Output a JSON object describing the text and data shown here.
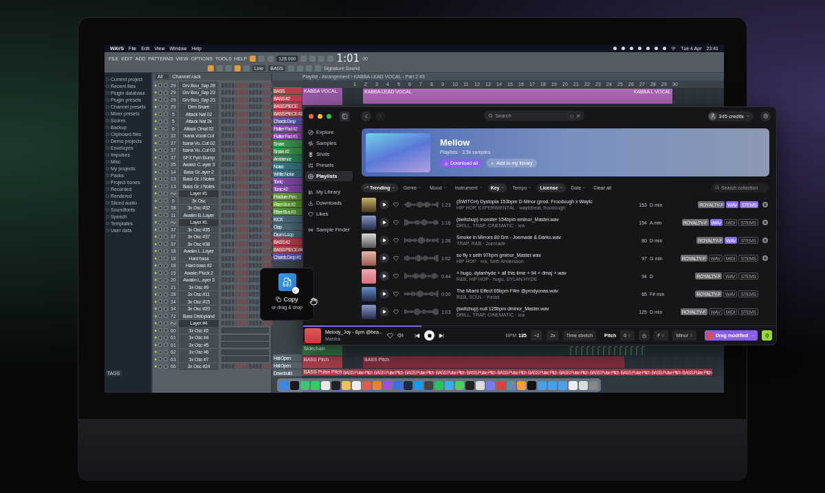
{
  "mac_menu_bar": {
    "app": "WAVS",
    "items": [
      "File",
      "Edit",
      "View",
      "Window",
      "Help"
    ],
    "date": "Tue 4 Apr",
    "time": "23:41"
  },
  "daw": {
    "menu": [
      "FILE",
      "EDIT",
      "ADD",
      "PATTERNS",
      "VIEW",
      "OPTIONS",
      "TOOLS",
      "HELP"
    ],
    "tempo": "128.000",
    "time": "1:01",
    "time_small": "00",
    "snap": "Line",
    "pattern": "BASS",
    "hint": "Signature Sound",
    "browser": {
      "items": [
        "Current project",
        "Recent files",
        "Plugin database",
        "Plugin presets",
        "Channel presets",
        "Mixer presets",
        "Scores",
        "Backup",
        "Clipboard files",
        "Demo projects",
        "Envelopes",
        "Impulses",
        "Misc",
        "My projects",
        "Packs",
        "Project bones",
        "Recorded",
        "Rendered",
        "Sliced audio",
        "Soundfonts",
        "Speech",
        "Templates",
        "User data"
      ],
      "tags": "TAGS"
    },
    "channel_rack": {
      "filter": "All",
      "title": "Channel rack",
      "channels": [
        {
          "number": "29",
          "name": "Grv Bou_Sap 28",
          "kind": "steps"
        },
        {
          "number": "29",
          "name": "Grv Bou_Sap 23",
          "kind": "steps"
        },
        {
          "number": "29",
          "name": "Grv Bou_Sap 23",
          "kind": "steps"
        },
        {
          "number": "29",
          "name": "Drm Snare",
          "kind": "steps"
        },
        {
          "number": "5",
          "name": "Attack Nat 02",
          "kind": "steps"
        },
        {
          "number": "5",
          "name": "Attack Nat 2k",
          "kind": "steps"
        },
        {
          "number": "6",
          "name": "Attack OHat 02",
          "kind": "steps"
        },
        {
          "number": "32",
          "name": "Isana Vocal Cut",
          "kind": "steps"
        },
        {
          "number": "37",
          "name": "Isana Vo..Cut 02",
          "kind": "steps"
        },
        {
          "number": "37",
          "name": "Isana Vo..Cut 03",
          "kind": "steps"
        },
        {
          "number": "37",
          "name": "SFX Fym Bump",
          "kind": "steps"
        },
        {
          "number": "35",
          "name": "Awakn C..ayer 3",
          "kind": "steps"
        },
        {
          "number": "14",
          "name": "Bass Gr..ayer 2",
          "kind": "steps"
        },
        {
          "number": "13",
          "name": "Bass Gr..I Notes",
          "kind": "steps"
        },
        {
          "number": "13",
          "name": "Bass Gr..I Notes",
          "kind": "steps"
        },
        {
          "name": "Layer #1",
          "kind": "steps"
        },
        {
          "number": "9",
          "name": "3x Osc",
          "kind": "steps"
        },
        {
          "number": "38",
          "name": "3x Osc #32",
          "kind": "steps"
        },
        {
          "number": "11",
          "name": "Awakn B..Layer",
          "kind": "steps"
        },
        {
          "name": "Layer #1",
          "kind": "steps"
        },
        {
          "number": "37",
          "name": "3x Osc #35",
          "kind": "steps"
        },
        {
          "number": "37",
          "name": "3x Osc #37",
          "kind": "steps"
        },
        {
          "number": "37",
          "name": "3x Osc #38",
          "kind": "steps"
        },
        {
          "number": "18",
          "name": "Awakn L..Layer",
          "kind": "steps"
        },
        {
          "number": "18",
          "name": "Hard bass",
          "kind": "steps"
        },
        {
          "number": "18",
          "name": "Hard bass #2",
          "kind": "steps"
        },
        {
          "number": "15",
          "name": "Awakn Pluck 2",
          "kind": "steps"
        },
        {
          "number": "20",
          "name": "Awakn L..ayer 3",
          "kind": "steps"
        },
        {
          "number": "21",
          "name": "3x Osc #9",
          "kind": "steps"
        },
        {
          "number": "28",
          "name": "3x Osc #11",
          "kind": "steps"
        },
        {
          "number": "34",
          "name": "3x Osc #15",
          "kind": "steps"
        },
        {
          "number": "34",
          "name": "3x Osc #20",
          "kind": "steps"
        },
        {
          "number": "72",
          "name": "Bass Distopiand",
          "kind": "steps"
        },
        {
          "name": "Layer #4",
          "kind": "steps"
        },
        {
          "number": "60",
          "name": "3x Osc #2",
          "kind": "roll"
        },
        {
          "number": "61",
          "name": "3x Osc #4",
          "kind": "roll"
        },
        {
          "number": "61",
          "name": "3x Osc #5",
          "kind": "roll"
        },
        {
          "number": "62",
          "name": "3x Osc #6",
          "kind": "roll"
        },
        {
          "number": "63",
          "name": "3x Osc #7",
          "kind": "roll"
        },
        {
          "number": "66",
          "name": "3x Osc #24",
          "kind": "steps"
        }
      ]
    },
    "playlist": {
      "title": "Playlist - Arrangement › KABBA LEAD VOCAL - Part 2 #3",
      "patterns": [
        {
          "name": "BASS",
          "color": "#b8404c"
        },
        {
          "name": "BASS #2",
          "color": "#b8404c"
        },
        {
          "name": "BASS PIECE",
          "color": "#b8404c"
        },
        {
          "name": "BASS PIECE #2",
          "color": "#b8404c"
        },
        {
          "name": "Chords Drop",
          "color": "#5a58b4"
        },
        {
          "name": "Flutter Pad #2",
          "color": "#8a48b4"
        },
        {
          "name": "Flutter Pad #3",
          "color": "#8a48b4"
        },
        {
          "name": "Snare",
          "color": "#3a9a4c"
        },
        {
          "name": "Snare #2",
          "color": "#3a9a4c"
        },
        {
          "name": "Ambience",
          "color": "#2e8a5c"
        },
        {
          "name": "Noise",
          "color": "#3a7688"
        },
        {
          "name": "White Noise",
          "color": "#3a7688"
        },
        {
          "name": "Tonic",
          "color": "#8848b0"
        },
        {
          "name": "Tonic #2",
          "color": "#8848b0"
        },
        {
          "name": "Fracture Perc",
          "color": "#6a9a3c"
        },
        {
          "name": "Riser Bus #2",
          "color": "#5a9a3c"
        },
        {
          "name": "Riser Bus #3",
          "color": "#5a9a3c"
        },
        {
          "name": "KICK",
          "color": "#4c6a7a"
        },
        {
          "name": "Clap",
          "color": "#4c6a7a"
        },
        {
          "name": "Drum Loop",
          "color": "#4c6a7a"
        },
        {
          "name": "BASS #2",
          "color": "#b8404c"
        },
        {
          "name": "BASS PIECE #4",
          "color": "#b8404c"
        },
        {
          "name": "Chords Drop #1",
          "color": "#5a58b4"
        }
      ],
      "patterns_lower": [
        {
          "name": "Hat Open",
          "color": "#56646e"
        },
        {
          "name": "Hat Open",
          "color": "#56646e"
        },
        {
          "name": "Downbuild",
          "color": "#56646e"
        }
      ],
      "ruler": [
        "1",
        "2",
        "3",
        "4",
        "5",
        "6",
        "7",
        "8",
        "9",
        "10",
        "11",
        "12",
        "13",
        "14",
        "15",
        "16",
        "17",
        "18",
        "19",
        "20",
        "21",
        "22",
        "23",
        "24",
        "25",
        "26",
        "27",
        "28",
        "29",
        "30"
      ],
      "vocal_track": "KABBA VOCAL",
      "vocal_clip": "KABBA LEAD VOCAL",
      "vocal_clip_end": "KABBA L VOCAL",
      "sidechain_track": "Sidechain",
      "pitch_track": "BASS Pitch",
      "pitch_clip": "BASS Pitch",
      "pulse_track": "BASS Pulse Pitch",
      "pulse_clips": [
        "BASS Pulse Pitch",
        "BASS Pulse Pitch",
        "BASS Pulse Pitch",
        "BASS Pulse Pitch",
        "BASS Pulse Pitch",
        "BASS Pulse Pitch",
        "BASS Pulse Pitch",
        "BASS Pulse Pitch",
        "BASS Pulse Pitch",
        "BASS Pulse Pitch",
        "BASS Pulse Pitch",
        "BASS Pulse Pitch"
      ]
    }
  },
  "app": {
    "search": {
      "placeholder": "Search"
    },
    "credits": "345 credits",
    "sidebar": {
      "groups": [
        {
          "items": [
            {
              "label": "Explore",
              "selected": false
            },
            {
              "label": "Samples",
              "selected": false
            },
            {
              "label": "Shots",
              "selected": false
            },
            {
              "label": "Presets",
              "selected": false
            },
            {
              "label": "Playlists",
              "selected": true
            }
          ]
        },
        {
          "items": [
            {
              "label": "My Library",
              "selected": false
            },
            {
              "label": "Downloads",
              "selected": false
            },
            {
              "label": "Likes",
              "selected": false
            }
          ]
        },
        {
          "items": [
            {
              "label": "Sample Finder",
              "selected": false
            }
          ]
        }
      ]
    },
    "header": {
      "title": "Mellow",
      "subtitle": "Playlists · 3.5k samples",
      "primary": "Download all",
      "secondary": "Add to my library"
    },
    "filters": [
      {
        "label": "Trending",
        "active": true
      },
      {
        "label": "Genre",
        "active": false
      },
      {
        "label": "Mood",
        "active": false
      },
      {
        "label": "Instrument",
        "active": false
      },
      {
        "label": "Key",
        "active": true
      },
      {
        "label": "Tempo",
        "active": false
      },
      {
        "label": "License",
        "active": true
      },
      {
        "label": "Date",
        "active": false
      }
    ],
    "clear": "Clear all",
    "collection_search": {
      "placeholder": "Search collection"
    },
    "samples": [
      {
        "duration": "1:23",
        "title": "(SWITCH) Dystopia 153bpm D Minor (prod. Froodough x Waytc",
        "meta": "HIP HOP, EXPERIMENTAL · waytcbeat, froodough",
        "bpm": "153",
        "key": "D min",
        "badges": [
          {
            "label": "ROYALTY-F",
            "highlighted": false
          },
          {
            "label": "WAV",
            "highlighted": true
          },
          {
            "label": "STEMS",
            "highlighted": true
          }
        ],
        "marked": true
      },
      {
        "duration": "1:16",
        "title": "(switchup) monster 154bpm eminor_Master.wav",
        "meta": "DRILL, TRAP, CINEMATIC · xra",
        "bpm": "154",
        "key": "A min",
        "badges": [
          {
            "label": "ROYALTY-F",
            "highlighted": false
          },
          {
            "label": "WAV",
            "highlighted": true
          },
          {
            "label": "MIDI",
            "highlighted": false
          },
          {
            "label": "STEMS",
            "highlighted": false
          }
        ],
        "marked": true
      },
      {
        "duration": "1:36",
        "title": "Smoke in Mirrors 80 Dm - Joemade & Darko.wav",
        "meta": "TRAP, R&B · Joemade",
        "bpm": "80",
        "key": "D min",
        "badges": [
          {
            "label": "ROYALTY-F",
            "highlighted": false
          },
          {
            "label": "WAV",
            "highlighted": true
          },
          {
            "label": "STEMS",
            "highlighted": false
          }
        ],
        "marked": true
      },
      {
        "duration": "1:02",
        "title": "so fly x seth 97bpm gminor_Master.wav",
        "meta": "HIP HOP · xra, Seth Andersson",
        "bpm": "97",
        "key": "G min",
        "badges": [
          {
            "label": "ROYALTY-F",
            "highlighted": false
          },
          {
            "label": "WAV",
            "highlighted": false
          },
          {
            "label": "MIDI",
            "highlighted": false
          },
          {
            "label": "STEMS",
            "highlighted": false
          }
        ],
        "marked": true
      },
      {
        "duration": "0:44",
        "title": "+ hugo, dylanhyde + all this time + 94 + dmaj +.wav",
        "meta": "R&B, HIP HOP · hugo, DYLAN HYDE",
        "bpm": "94",
        "key": "D",
        "badges": [
          {
            "label": "ROYALTY-F",
            "highlighted": false
          },
          {
            "label": "WAV",
            "highlighted": false
          },
          {
            "label": "STEMS",
            "highlighted": false
          }
        ],
        "marked": false
      },
      {
        "duration": "0:30",
        "title": "The Miami Effect 65bpm F#m @prodyonas.wav",
        "meta": "R&B, SOUL · Yonas",
        "bpm": "65",
        "key": "F# min",
        "badges": [
          {
            "label": "ROYALTY-F",
            "highlighted": false
          },
          {
            "label": "WAV",
            "highlighted": false
          },
          {
            "label": "STEMS",
            "highlighted": false
          }
        ],
        "marked": false
      },
      {
        "duration": "1:03",
        "title": "(switchup) null 125bpm dminor_Master.wav",
        "meta": "DRILL, TRAP, CINEMATIC · xra",
        "bpm": "125",
        "key": "D min",
        "badges": [
          {
            "label": "ROYALTY-F",
            "highlighted": false
          },
          {
            "label": "WAV",
            "highlighted": false
          },
          {
            "label": "MIDI",
            "highlighted": false
          },
          {
            "label": "STEMS",
            "highlighted": false
          }
        ],
        "marked": false
      }
    ],
    "player": {
      "title": "Melody_Joy - 8pm @bea...",
      "artist": "Mantra",
      "progress": {
        "level": 0.25
      },
      "bpm_label": "BPM",
      "bpm": "135",
      "half": "÷2",
      "double": "2x",
      "stretch": "Time stretch",
      "pitch_label": "Pitch",
      "pitch": "0",
      "key": "F",
      "scale": "Minor",
      "drag": "Drag modified"
    }
  },
  "copy_popup": {
    "title": "Copy",
    "hint": "or drag & drop"
  }
}
